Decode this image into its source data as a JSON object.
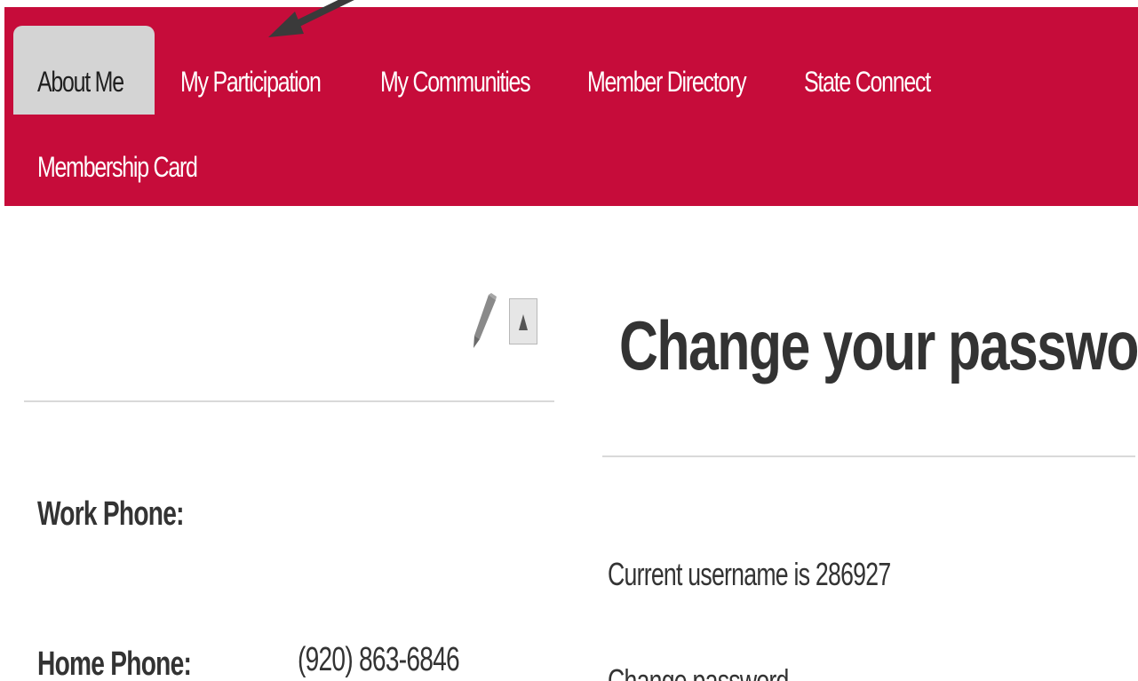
{
  "nav": {
    "accent_color": "#c60c3a",
    "tabs": [
      {
        "label": "About Me",
        "active": true
      },
      {
        "label": "My Participation",
        "active": false
      },
      {
        "label": "My Communities",
        "active": false
      },
      {
        "label": "Member Directory",
        "active": false
      },
      {
        "label": "State Connect",
        "active": false
      },
      {
        "label": "Membership Card",
        "active": false
      }
    ]
  },
  "profile_panel": {
    "edit_icon": "pencil-icon",
    "collapse_icon": "triangle-up-icon",
    "fields": [
      {
        "label": "Work Phone:",
        "value": ""
      },
      {
        "label": "Home Phone:",
        "value": "(920) 863-6846"
      }
    ]
  },
  "password_panel": {
    "title": "Change your password",
    "username_text": "Current username is  286927",
    "next_text": "Change password"
  },
  "annotation": {
    "icon": "arrow-annotation"
  }
}
